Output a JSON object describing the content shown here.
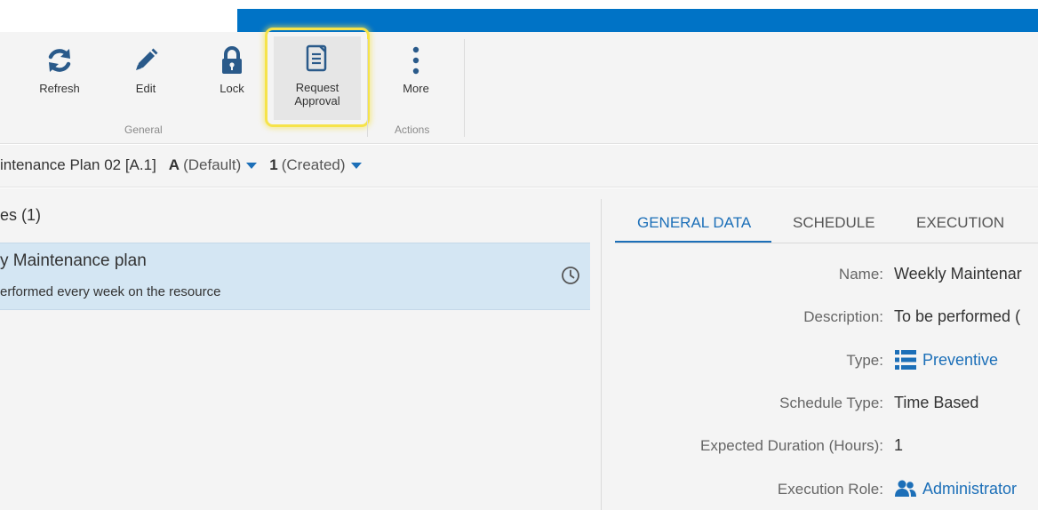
{
  "ribbon": {
    "buttons": {
      "refresh": "Refresh",
      "edit": "Edit",
      "lock": "Lock",
      "request_approval_line1": "Request",
      "request_approval_line2": "Approval",
      "more": "More"
    },
    "groups": {
      "general": "General",
      "actions": "Actions"
    }
  },
  "breadcrumb": {
    "name": "intenance Plan 02 [A.1]",
    "revision_letter": "A",
    "revision_state": "(Default)",
    "version_number": "1",
    "version_state": "(Created)"
  },
  "list": {
    "title": "es (1)",
    "items": [
      {
        "title": "y Maintenance plan",
        "subtitle": "erformed every week on the resource",
        "icon": "clock-icon"
      }
    ]
  },
  "tabs": [
    "GENERAL DATA",
    "SCHEDULE",
    "EXECUTION"
  ],
  "active_tab": "GENERAL DATA",
  "fields": [
    {
      "label": "Name:",
      "value": "Weekly Maintenar"
    },
    {
      "label": "Description:",
      "value": "To be performed ("
    },
    {
      "label": "Type:",
      "value": "Preventive",
      "icon": "list-icon"
    },
    {
      "label": "Schedule Type:",
      "value": "Time Based"
    },
    {
      "label": "Expected Duration (Hours):",
      "value": "1"
    },
    {
      "label": "Execution Role:",
      "value": "Administrator",
      "icon": "users-icon"
    }
  ],
  "colors": {
    "accent": "#1c6fb8",
    "top_bar": "#0073c6",
    "highlight": "#f6e34a",
    "selected_row": "#d4e6f3"
  }
}
